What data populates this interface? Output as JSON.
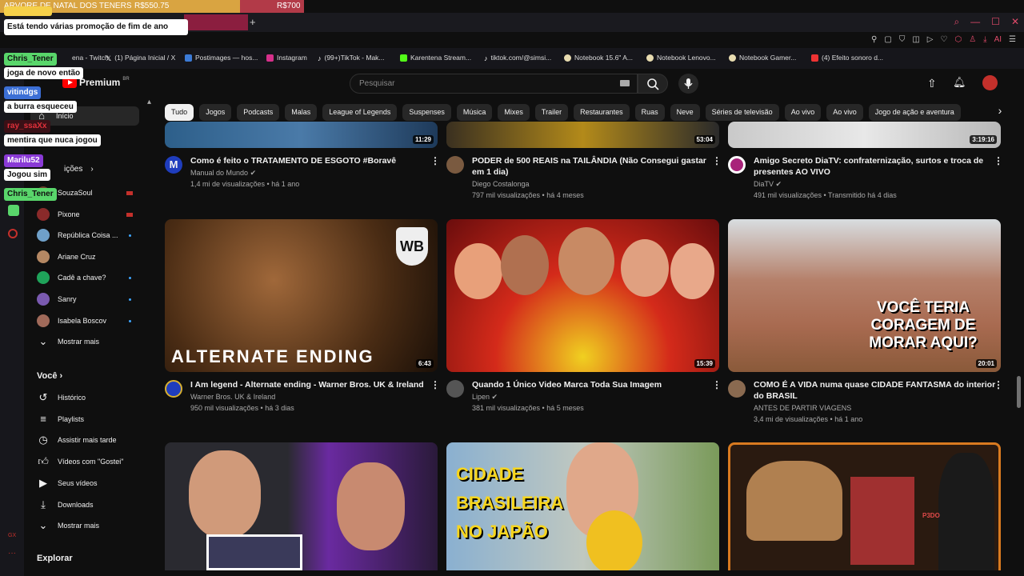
{
  "stream_overlay": {
    "goal_label": "ARVORE DE NATAL DOS TENERS",
    "goal_current": "R$550.75",
    "goal_target": "R$700",
    "goal_progress": 0.79,
    "chat": [
      {
        "user": "",
        "message": "Está tendo várias promoção de fim de ano"
      },
      {
        "user": "Chris_Tener",
        "message": "joga de novo então"
      },
      {
        "user": "vitindgs",
        "message": "a burra esqueceu"
      },
      {
        "user": "ray_ssaXx",
        "message": "mentira que nuca jogou"
      },
      {
        "user": "Marilu52",
        "message": "Jogou sim"
      },
      {
        "user": "Chris_Tener",
        "message": ""
      }
    ]
  },
  "bookmarks": [
    "ena - Twitch",
    "(1) Página Inicial / X",
    "Postimages — hos...",
    "Instagram",
    "(99+)TikTok - Mak...",
    "Karentena Stream...",
    "tiktok.com/@simsi...",
    "Notebook 15.6\" A...",
    "Notebook Lenovo...",
    "Notebook Gamer...",
    "(4) Efeito sonoro d..."
  ],
  "header": {
    "logo": "Premium",
    "logo_badge": "BR",
    "search_placeholder": "Pesquisar"
  },
  "chips": [
    "Tudo",
    "Jogos",
    "Podcasts",
    "Malas",
    "League of Legends",
    "Suspenses",
    "Música",
    "Mixes",
    "Trailer",
    "Restaurantes",
    "Ruas",
    "Neve",
    "Séries de televisão",
    "Ao vivo",
    "Ao vivo",
    "Jogo de ação e aventura"
  ],
  "sidebar": {
    "home_label": "Início",
    "subscriptions_label": "ições",
    "subscriptions": [
      {
        "name": "SouzaSoul",
        "status": "live"
      },
      {
        "name": "Pixone",
        "status": "live"
      },
      {
        "name": "República Coisa ...",
        "status": "dot"
      },
      {
        "name": "Ariane Cruz",
        "status": ""
      },
      {
        "name": "Cadê a chave?",
        "status": "dot"
      },
      {
        "name": "Sanry",
        "status": "dot"
      },
      {
        "name": "Isabela Boscov",
        "status": "dot"
      }
    ],
    "show_more": "Mostrar mais",
    "you_label": "Você",
    "you_items": [
      {
        "label": "Histórico",
        "icon": "history-icon"
      },
      {
        "label": "Playlists",
        "icon": "playlist-icon"
      },
      {
        "label": "Assistir mais tarde",
        "icon": "clock-icon"
      },
      {
        "label": "Vídeos com \"Gostei\"",
        "icon": "thumb-up-icon"
      },
      {
        "label": "Seus vídeos",
        "icon": "your-videos-icon"
      },
      {
        "label": "Downloads",
        "icon": "download-icon"
      }
    ],
    "show_more_2": "Mostrar mais",
    "explore_label": "Explorar"
  },
  "videos_row1": [
    {
      "duration": "11:29",
      "title1": "Como é feito o TRATAMENTO DE ESGOTO #Boravê",
      "title2": "",
      "channel": "Manual do Mundo",
      "verified": "✔",
      "meta": "1,4 mi de visualizações • há 1 ano"
    },
    {
      "duration": "53:04",
      "title1": "PODER de 500 REAIS na TAILÂNDIA (Não Consegui gastar",
      "title2": "em 1 dia)",
      "channel": "Diego Costalonga",
      "verified": "",
      "meta": "797 mil visualizações • há 4 meses"
    },
    {
      "duration": "3:19:16",
      "title1": "Amigo Secreto DiaTV: confraternização, surtos e troca de",
      "title2": "presentes AO VIVO",
      "channel": "DiaTV",
      "verified": "✔",
      "meta": "491 mil visualizações • Transmitido há 4 dias"
    }
  ],
  "videos_row2": [
    {
      "duration": "6:43",
      "overlay": "ALTERNATE ENDING",
      "title1": "I Am legend - Alternate ending - Warner Bros. UK & Ireland",
      "title2": "",
      "channel": "Warner Bros. UK & Ireland",
      "verified": "",
      "meta": "950 mil visualizações • há 3 dias"
    },
    {
      "duration": "15:39",
      "overlay": "",
      "title1": "Quando 1 Único Video Marca Toda Sua Imagem",
      "title2": "",
      "channel": "Lipen",
      "verified": "✔",
      "meta": "381 mil visualizações • há 5 meses"
    },
    {
      "duration": "20:01",
      "overlay": "VOCÊ TERIA CORAGEM DE MORAR AQUI?",
      "title1": "COMO É A VIDA numa quase CIDADE FANTASMA do interior",
      "title2": "do BRASIL",
      "channel": "ANTES DE PARTIR VIAGENS",
      "verified": "",
      "meta": "3,4 mi de visualizações • há 1 ano"
    }
  ],
  "videos_row3": [
    {
      "overlay": ""
    },
    {
      "overlay": "CIDADE BRASILEIRA NO JAPÃO"
    },
    {
      "overlay": "P3DO"
    }
  ],
  "colors": {
    "accent": "#ff0000",
    "live": "#c4302b",
    "dot": "#3ea6ff"
  }
}
